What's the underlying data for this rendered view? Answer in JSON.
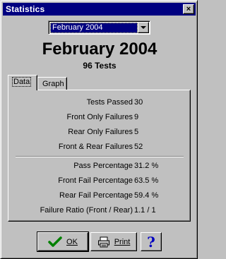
{
  "window": {
    "title": "Statistics",
    "close_glyph": "×"
  },
  "period_select": {
    "selected": "February 2004"
  },
  "heading": {
    "title": "February 2004",
    "subtitle": "96 Tests"
  },
  "tabs": [
    {
      "label": "Data",
      "active": true
    },
    {
      "label": "Graph",
      "active": false
    }
  ],
  "counts": [
    {
      "label": "Tests Passed",
      "value": "30"
    },
    {
      "label": "Front Only Failures",
      "value": "9"
    },
    {
      "label": "Rear Only Failures",
      "value": "5"
    },
    {
      "label": "Front & Rear Failures",
      "value": "52"
    }
  ],
  "percentages": [
    {
      "label": "Pass Percentage",
      "value": "31.2 %"
    },
    {
      "label": "Front Fail Percentage",
      "value": "63.5 %"
    },
    {
      "label": "Rear Fail Percentage",
      "value": "59.4 %"
    },
    {
      "label": "Failure Ratio (Front / Rear)",
      "value": "1.1  / 1"
    }
  ],
  "buttons": {
    "ok": "OK",
    "print": "Print",
    "help": "?"
  },
  "colors": {
    "titlebar": "#000080",
    "face": "#c0c0c0",
    "check": "#008000",
    "help": "#0000c0"
  },
  "icons": {
    "ok": "checkmark-icon",
    "print": "printer-icon",
    "help": "question-mark-icon"
  }
}
